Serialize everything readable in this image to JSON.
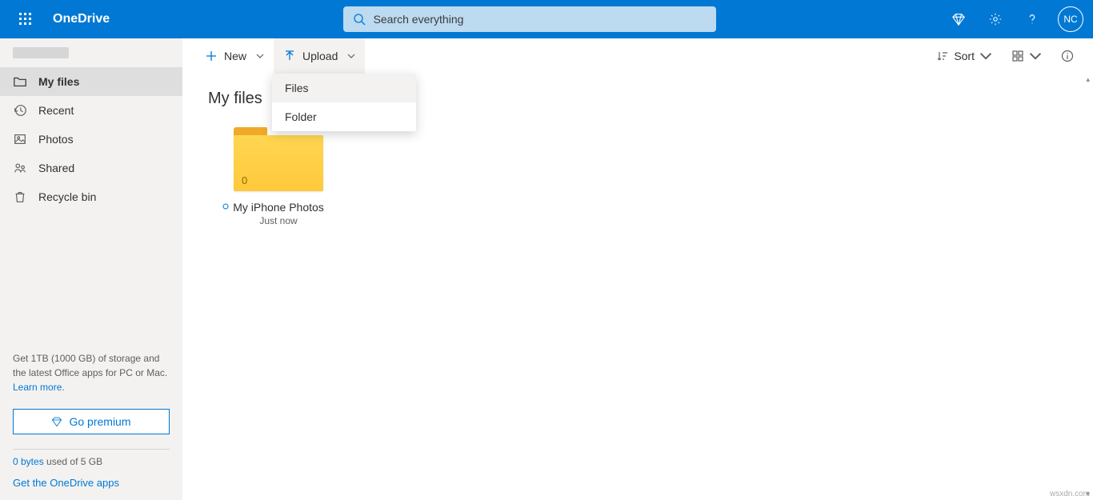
{
  "app_name": "OneDrive",
  "search": {
    "placeholder": "Search everything"
  },
  "avatar_initials": "NC",
  "sidebar": {
    "items": [
      {
        "label": "My files",
        "icon": "folder-icon",
        "active": true
      },
      {
        "label": "Recent",
        "icon": "recent-icon"
      },
      {
        "label": "Photos",
        "icon": "photos-icon"
      },
      {
        "label": "Shared",
        "icon": "shared-icon"
      },
      {
        "label": "Recycle bin",
        "icon": "recycle-icon"
      }
    ]
  },
  "promo": {
    "text_a": "Get 1TB (1000 GB) of storage and the latest Office apps for PC or Mac.",
    "learn_more": "Learn more.",
    "premium_btn": "Go premium"
  },
  "storage": {
    "used_label": "0 bytes",
    "of_label": " used of 5 GB"
  },
  "get_apps": "Get the OneDrive apps",
  "toolbar": {
    "new_label": "New",
    "upload_label": "Upload",
    "sort_label": "Sort"
  },
  "upload_menu": {
    "files": "Files",
    "folder": "Folder"
  },
  "page_title": "My files",
  "tiles": [
    {
      "name": "My iPhone Photos",
      "sub": "Just now",
      "count": "0"
    }
  ],
  "watermark": "wsxdn.com"
}
